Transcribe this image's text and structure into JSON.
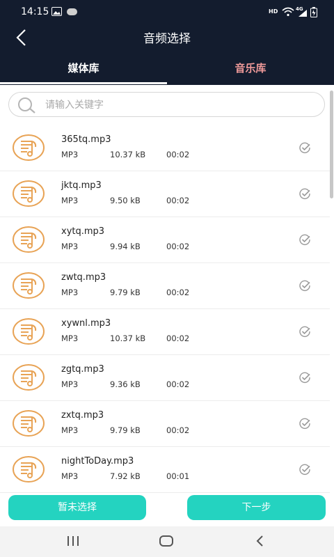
{
  "status_bar": {
    "time": "14:15",
    "network": "HD",
    "signal": "4G"
  },
  "header": {
    "title": "音频选择"
  },
  "tabs": [
    {
      "label": "媒体库"
    },
    {
      "label": "音乐库"
    }
  ],
  "search": {
    "placeholder": "请输入关键字",
    "value": ""
  },
  "files": [
    {
      "name": "365tq.mp3",
      "format": "MP3",
      "size": "10.37 kB",
      "duration": "00:02"
    },
    {
      "name": "jktq.mp3",
      "format": "MP3",
      "size": "9.50 kB",
      "duration": "00:02"
    },
    {
      "name": "xytq.mp3",
      "format": "MP3",
      "size": "9.94 kB",
      "duration": "00:02"
    },
    {
      "name": "zwtq.mp3",
      "format": "MP3",
      "size": "9.79 kB",
      "duration": "00:02"
    },
    {
      "name": "xywnl.mp3",
      "format": "MP3",
      "size": "10.37 kB",
      "duration": "00:02"
    },
    {
      "name": "zgtq.mp3",
      "format": "MP3",
      "size": "9.36 kB",
      "duration": "00:02"
    },
    {
      "name": "zxtq.mp3",
      "format": "MP3",
      "size": "9.79 kB",
      "duration": "00:02"
    },
    {
      "name": "nightToDay.mp3",
      "format": "MP3",
      "size": "7.92 kB",
      "duration": "00:01"
    }
  ],
  "footer": {
    "deselect_label": "暂未选择",
    "next_label": "下一步"
  },
  "colors": {
    "header_bg": "#131c2e",
    "accent": "#24d3c0",
    "file_icon": "#e8a355",
    "inactive_tab": "#f09a9a"
  }
}
